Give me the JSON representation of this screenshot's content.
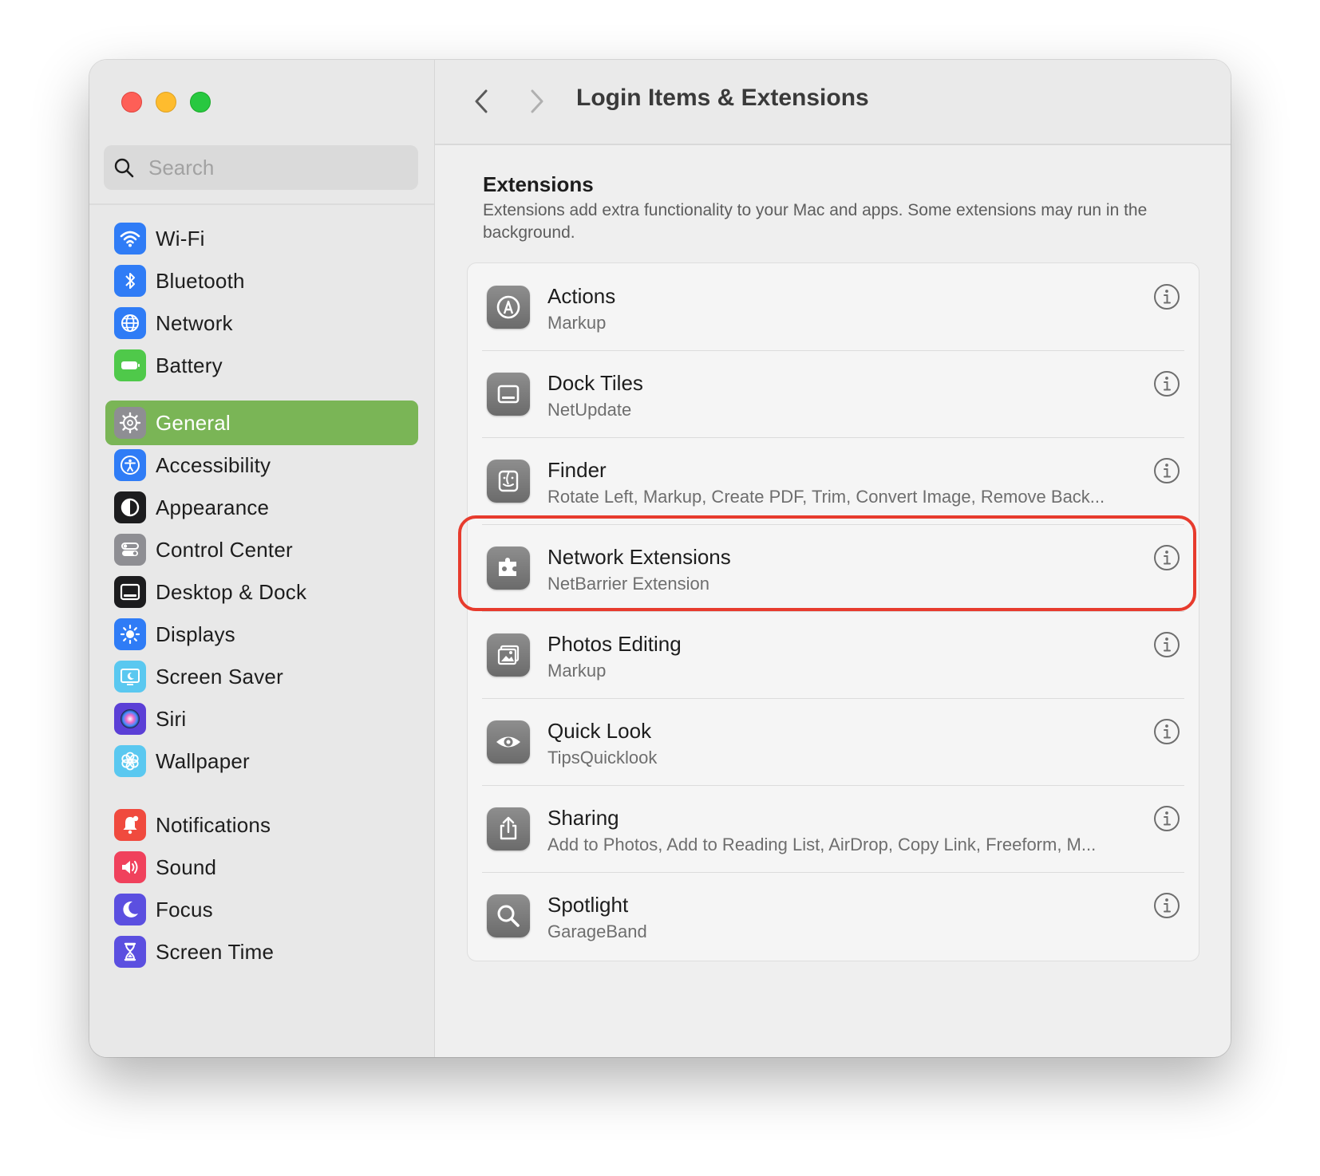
{
  "window": {
    "title": "Login Items & Extensions"
  },
  "sidebar": {
    "search_placeholder": "Search",
    "groups": [
      [
        {
          "label": "Wi-Fi",
          "icon": "wifi-icon",
          "color": "#2f7cf6"
        },
        {
          "label": "Bluetooth",
          "icon": "bluetooth-icon",
          "color": "#2f7cf6"
        },
        {
          "label": "Network",
          "icon": "globe-icon",
          "color": "#2f7cf6"
        },
        {
          "label": "Battery",
          "icon": "battery-icon",
          "color": "#4fc94a"
        }
      ],
      [
        {
          "label": "General",
          "icon": "gear-icon",
          "color": "#8e8e93",
          "active": true
        },
        {
          "label": "Accessibility",
          "icon": "accessibility-icon",
          "color": "#2f7cf6"
        },
        {
          "label": "Appearance",
          "icon": "appearance-icon",
          "color": "#1c1c1e"
        },
        {
          "label": "Control Center",
          "icon": "control-center-icon",
          "color": "#8e8e93"
        },
        {
          "label": "Desktop & Dock",
          "icon": "desktop-dock-icon",
          "color": "#1c1c1e"
        },
        {
          "label": "Displays",
          "icon": "sun-icon",
          "color": "#2f7cf6"
        },
        {
          "label": "Screen Saver",
          "icon": "screen-saver-icon",
          "color": "#5ac8f0"
        },
        {
          "label": "Siri",
          "icon": "siri-icon",
          "color": "#5b3fd6"
        },
        {
          "label": "Wallpaper",
          "icon": "flower-icon",
          "color": "#5ac8f0"
        }
      ],
      [
        {
          "label": "Notifications",
          "icon": "bell-icon",
          "color": "#f04a3e"
        },
        {
          "label": "Sound",
          "icon": "speaker-icon",
          "color": "#f0415c"
        },
        {
          "label": "Focus",
          "icon": "moon-icon",
          "color": "#5b4fe0"
        },
        {
          "label": "Screen Time",
          "icon": "hourglass-icon",
          "color": "#5b4fe0"
        }
      ]
    ]
  },
  "main": {
    "section_title": "Extensions",
    "section_desc": "Extensions add extra functionality to your Mac and apps. Some extensions may run in the background.",
    "rows": [
      {
        "title": "Actions",
        "subtitle": "Markup",
        "icon": "markup-icon"
      },
      {
        "title": "Dock Tiles",
        "subtitle": "NetUpdate",
        "icon": "dock-icon"
      },
      {
        "title": "Finder",
        "subtitle": "Rotate Left, Markup, Create PDF, Trim, Convert Image, Remove Back...",
        "icon": "finder-icon"
      },
      {
        "title": "Network Extensions",
        "subtitle": "NetBarrier Extension",
        "icon": "puzzle-icon",
        "highlighted": true
      },
      {
        "title": "Photos Editing",
        "subtitle": "Markup",
        "icon": "photos-icon"
      },
      {
        "title": "Quick Look",
        "subtitle": "TipsQuicklook",
        "icon": "eye-icon"
      },
      {
        "title": "Sharing",
        "subtitle": "Add to Photos, Add to Reading List, AirDrop, Copy Link, Freeform, M...",
        "icon": "share-icon"
      },
      {
        "title": "Spotlight",
        "subtitle": "GarageBand",
        "icon": "magnifier-icon"
      }
    ],
    "help_label": "?"
  },
  "colors": {
    "highlight": "#e73b2d",
    "active_sidebar": "#7ab556"
  }
}
